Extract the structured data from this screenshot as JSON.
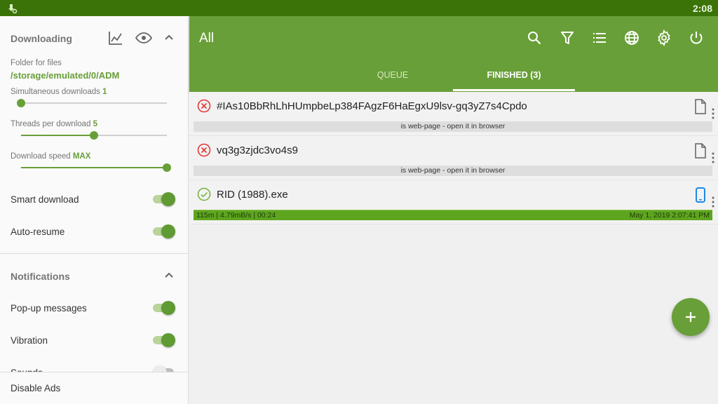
{
  "status_bar": {
    "app_icon": "adm-download-icon",
    "time": "2:08"
  },
  "sidebar": {
    "downloading": {
      "title": "Downloading",
      "icons": [
        "chart-icon",
        "eye-icon",
        "chevron-up-icon"
      ],
      "folder_label": "Folder for files",
      "folder_path": "/storage/emulated/0/ADM",
      "simultaneous_label": "Simultaneous downloads",
      "simultaneous_value": "1",
      "simultaneous_fraction": 0,
      "threads_label": "Threads per download",
      "threads_value": "5",
      "threads_fraction": 0.5,
      "speed_label": "Download speed",
      "speed_value": "MAX",
      "speed_fraction": 1.0,
      "smart_download_label": "Smart download",
      "smart_download_on": true,
      "auto_resume_label": "Auto-resume",
      "auto_resume_on": true
    },
    "notifications": {
      "title": "Notifications",
      "popup_label": "Pop-up messages",
      "popup_on": true,
      "vibration_label": "Vibration",
      "vibration_on": true,
      "sounds_label": "Sounds",
      "sounds_on": false
    },
    "disable_ads_label": "Disable Ads"
  },
  "appbar": {
    "title": "All",
    "actions": [
      "search-icon",
      "filter-icon",
      "list-icon",
      "globe-icon",
      "settings-icon",
      "power-icon"
    ],
    "tabs": [
      {
        "label": "QUEUE",
        "active": false
      },
      {
        "label": "FINISHED (3)",
        "active": true
      }
    ]
  },
  "downloads": [
    {
      "name": "#IAs10BbRhLhHUmpbeLp384FAgzF6HaEgxU9lsv-gq3yZ7s4Cpdo",
      "status": "error",
      "file_type": "document",
      "info": "is web-page - open it in browser"
    },
    {
      "name": "vq3g3zjdc3vo4s9",
      "status": "error",
      "file_type": "document",
      "info": "is web-page - open it in browser"
    },
    {
      "name": "RID (1988).exe",
      "status": "success",
      "file_type": "application",
      "stats": "115m  |  4.79mB/s  |  00:24",
      "date": "May 1, 2019 2:07:41 PM",
      "progress": 1.0
    }
  ],
  "fab": {
    "icon": "plus-icon"
  },
  "colors": {
    "primary": "#689f38",
    "status_bar": "#3b7309",
    "error": "#e53935",
    "success": "#7cb342",
    "progress_complete": "#5ea51f",
    "app_icon_blue": "#1e88e5"
  }
}
